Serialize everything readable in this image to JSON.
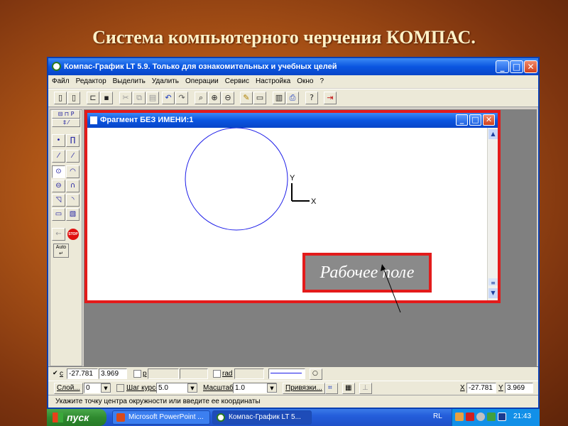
{
  "slide": {
    "title": "Система компьютерного черчения КОМПАС."
  },
  "window": {
    "title": "Компас-График LT 5.9. Только для ознакомительных и учебных целей",
    "buttons": {
      "minimize": "_",
      "maximize": "□",
      "close": "✕"
    }
  },
  "menu": [
    "Файл",
    "Редактор",
    "Выделить",
    "Удалить",
    "Операции",
    "Сервис",
    "Настройка",
    "Окно",
    "?"
  ],
  "document": {
    "title": "Фрагмент БЕЗ ИМЕНИ:1",
    "axis_y": "Y",
    "axis_x": "X"
  },
  "callout": {
    "text": "Рабочее поле"
  },
  "left_panel": {
    "auto_label": "Auto",
    "stop_label": "STOP"
  },
  "status": {
    "coord_label_c": "c",
    "field_x": "-27.781",
    "field_y": "3.969",
    "label_p": "p",
    "label_rad": "rad",
    "layer_button": "Слой...",
    "layer_value": "0",
    "step_label": "Шаг курсора",
    "step_value": "5.0",
    "scale_label": "Масштаб",
    "scale_value": "1.0",
    "snap_button": "Привязки...",
    "cursor_x_label": "X",
    "cursor_x": "-27.781",
    "cursor_y_label": "Y",
    "cursor_y": "3.969",
    "hint": "Укажите точку центра окружности или введите ее координаты"
  },
  "taskbar": {
    "start_label": "пуск",
    "items": [
      "Microsoft PowerPoint ...",
      "Компас-График LT 5..."
    ],
    "lang": "RL",
    "clock": "21:43"
  },
  "colors": {
    "highlight": "#e31b1b",
    "circle": "#1a1ae8",
    "titlebar": "#0a55e0"
  }
}
